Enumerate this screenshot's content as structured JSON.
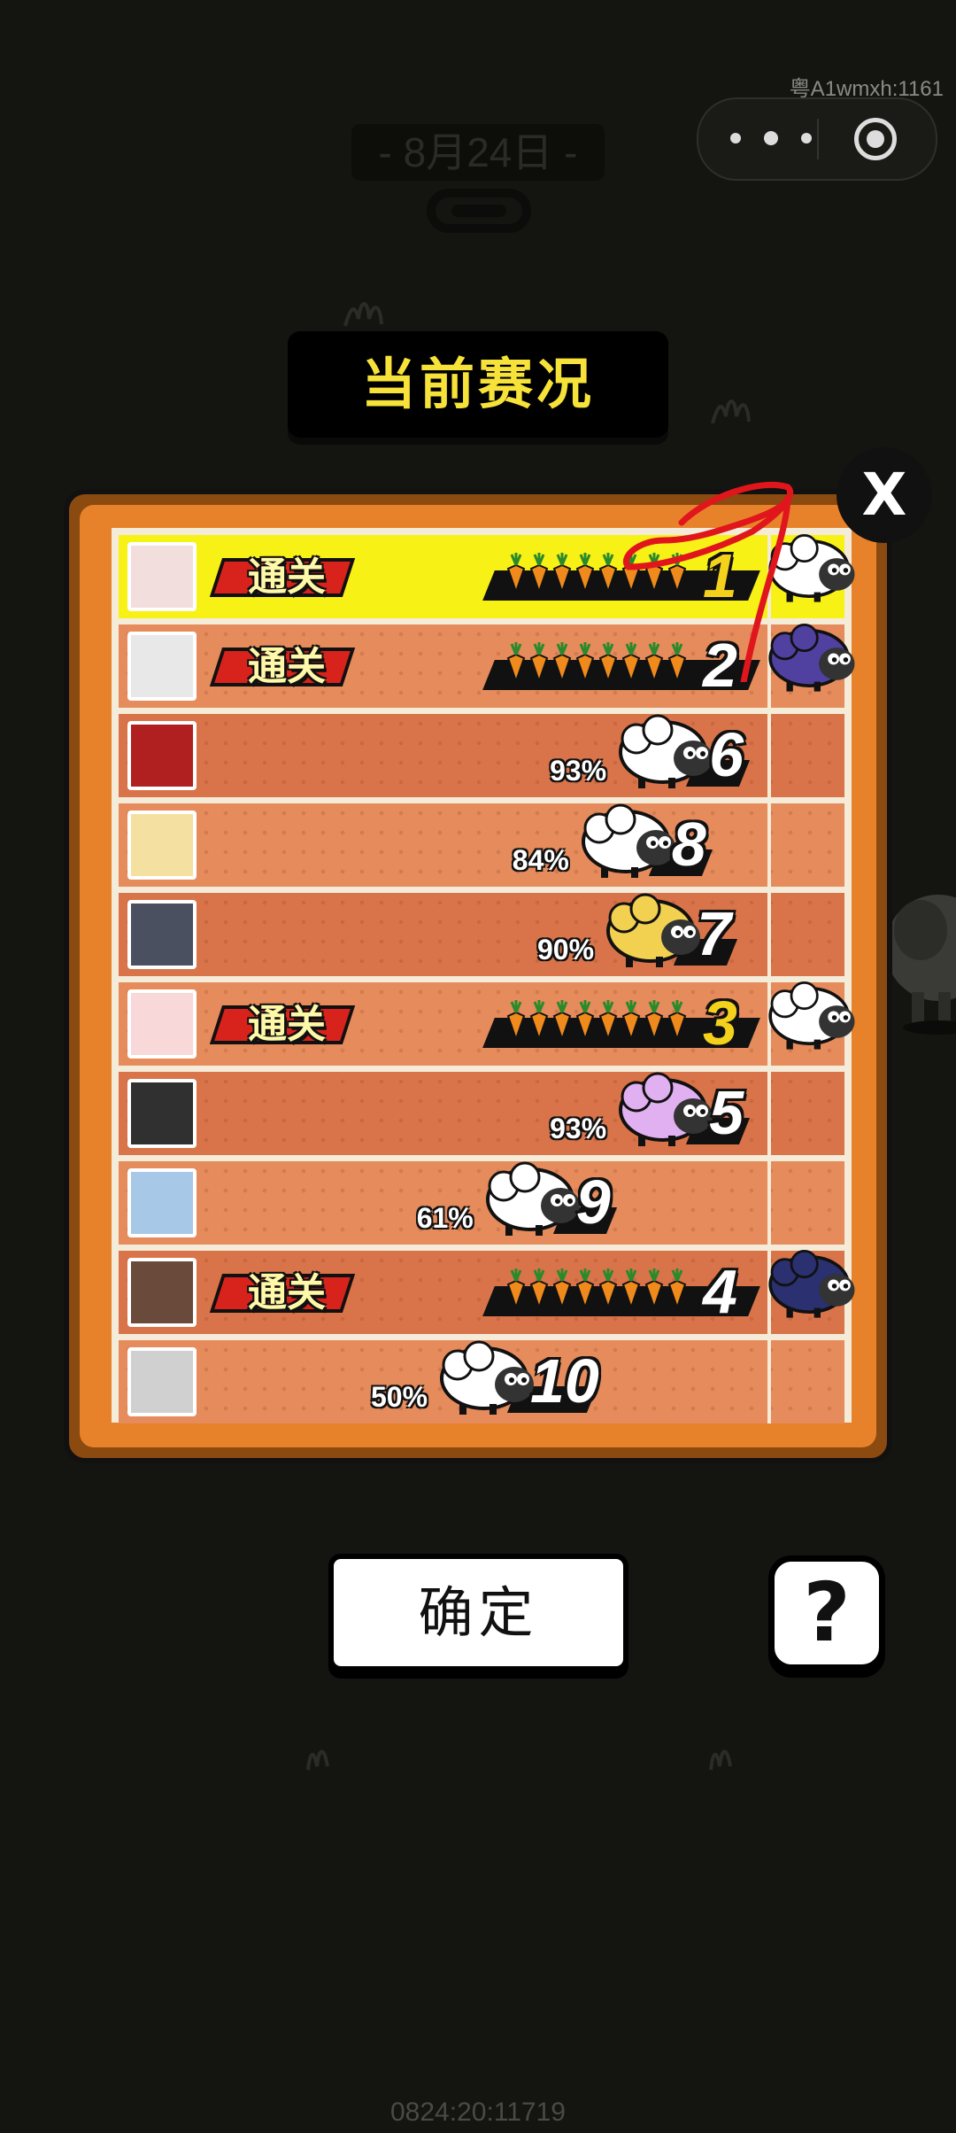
{
  "watermark": "粤A1wmxh:1161",
  "date": "- 8月24日 -",
  "title": "当前赛况",
  "close_label": "X",
  "clear_label": "通关",
  "rows": [
    {
      "rank": "1",
      "status": "cleared",
      "carrots": 8,
      "pct": "",
      "trophy": "white-sheep"
    },
    {
      "rank": "2",
      "status": "cleared",
      "carrots": 8,
      "pct": "",
      "trophy": "galaxy-sheep"
    },
    {
      "rank": "6",
      "status": "progress",
      "pct": "93%",
      "sheep": "white-sheep"
    },
    {
      "rank": "8",
      "status": "progress",
      "pct": "84%",
      "sheep": "white-sheep"
    },
    {
      "rank": "7",
      "status": "progress",
      "pct": "90%",
      "sheep": "teapot-sheep"
    },
    {
      "rank": "3",
      "status": "cleared",
      "carrots": 8,
      "pct": "",
      "trophy": "white-sheep"
    },
    {
      "rank": "5",
      "status": "progress",
      "pct": "93%",
      "sheep": "cake-sheep"
    },
    {
      "rank": "9",
      "status": "progress",
      "pct": "61%",
      "sheep": "white-sheep"
    },
    {
      "rank": "4",
      "status": "cleared",
      "carrots": 8,
      "pct": "",
      "trophy": "night-sheep"
    },
    {
      "rank": "10",
      "status": "progress",
      "pct": "50%",
      "sheep": "white-sheep"
    }
  ],
  "confirm_label": "确定",
  "help_label": "?",
  "footer_id": "0824:20:11719",
  "colors": {
    "title": "#f7e23a",
    "first_row": "#f8f116",
    "row": "#e58b5c",
    "clear_tag": "#d8231c"
  }
}
